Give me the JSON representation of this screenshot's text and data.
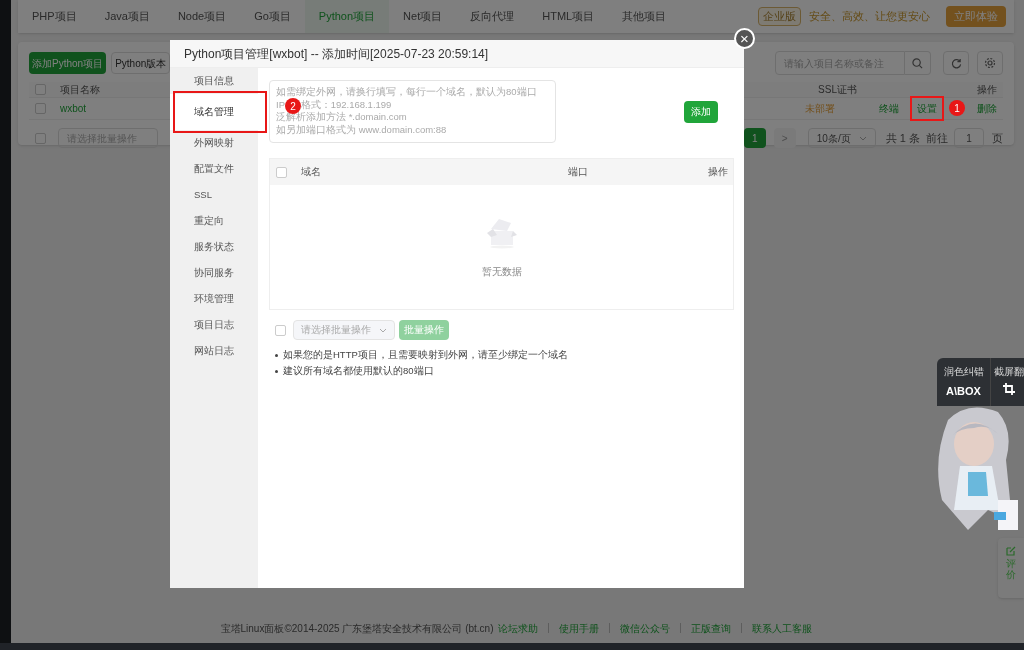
{
  "nav_tabs": [
    {
      "label": "PHP项目",
      "selected": false
    },
    {
      "label": "Java项目",
      "selected": false
    },
    {
      "label": "Node项目",
      "selected": false
    },
    {
      "label": "Go项目",
      "selected": false
    },
    {
      "label": "Python项目",
      "selected": true
    },
    {
      "label": "Net项目",
      "selected": false
    },
    {
      "label": "反向代理",
      "selected": false
    },
    {
      "label": "HTML项目",
      "selected": false
    },
    {
      "label": "其他项目",
      "selected": false
    }
  ],
  "promo": {
    "badge": "企业版",
    "slogan": "安全、高效、让您更安心",
    "button": "立即体验"
  },
  "toolbar": {
    "add_button": "添加Python项目",
    "version_button": "Python版本",
    "search_placeholder": "请输入项目名称或备注"
  },
  "projects": {
    "select_all": {
      "checked": false
    },
    "columns": [
      "项目名称",
      "SSL证书",
      "操作"
    ],
    "rows": [
      {
        "checked": false,
        "name": "wxbot",
        "ssl": "未部署",
        "actions": [
          {
            "label": "终端"
          },
          {
            "label": "设置",
            "annotation": "1"
          },
          {
            "label": "删除"
          }
        ]
      }
    ]
  },
  "bulk": {
    "checked": false,
    "placeholder": "请选择批量操作"
  },
  "pagination": {
    "pages": [
      {
        "label": "1",
        "selected": true
      }
    ],
    "next": ">",
    "page_size": "10条/页",
    "total": "共 1 条",
    "goto_label": "前往",
    "goto_value": "1",
    "page_suffix": "页"
  },
  "modal": {
    "title": "Python项目管理[wxbot] -- 添加时间[2025-07-23 20:59:14]",
    "close": "×",
    "nav": [
      {
        "label": "项目信息",
        "selected": false
      },
      {
        "label": "域名管理",
        "selected": true,
        "annotation": "2"
      },
      {
        "label": "外网映射",
        "selected": false
      },
      {
        "label": "配置文件",
        "selected": false
      },
      {
        "label": "SSL",
        "selected": false
      },
      {
        "label": "重定向",
        "selected": false
      },
      {
        "label": "服务状态",
        "selected": false
      },
      {
        "label": "协同服务",
        "selected": false
      },
      {
        "label": "环境管理",
        "selected": false
      },
      {
        "label": "项目日志",
        "selected": false
      },
      {
        "label": "网站日志",
        "selected": false
      }
    ],
    "domain_placeholder": "如需绑定外网，请换行填写，每行一个域名，默认为80端口\nIP      格式：192.168.1.199\n泛解析添加方法 *.domain.com\n如另加端口格式为 www.domain.com:88",
    "add_button": "添加",
    "table": {
      "select_all": {
        "checked": false
      },
      "columns": [
        "域名",
        "端口",
        "操作"
      ],
      "empty_text": "暂无数据"
    },
    "bulk_checked": false,
    "bulk_placeholder": "请选择批量操作",
    "bulk_button": "批量操作",
    "notes": [
      "如果您的是HTTP项目，且需要映射到外网，请至少绑定一个域名",
      "建议所有域名都使用默认的80端口"
    ]
  },
  "assistant": {
    "tools": [
      {
        "label": "润色纠错",
        "kind": "logo",
        "logo": "A\\BOX"
      },
      {
        "label": "截屏翻",
        "kind": "crop"
      }
    ],
    "side_tab": "评价"
  },
  "footer": {
    "copyright": "宝塔Linux面板©2014-2025 广东堡塔安全技术有限公司 (bt.cn)",
    "links": [
      "论坛求助",
      "使用手册",
      "微信公众号",
      "正版查询",
      "联系人工客服"
    ]
  }
}
